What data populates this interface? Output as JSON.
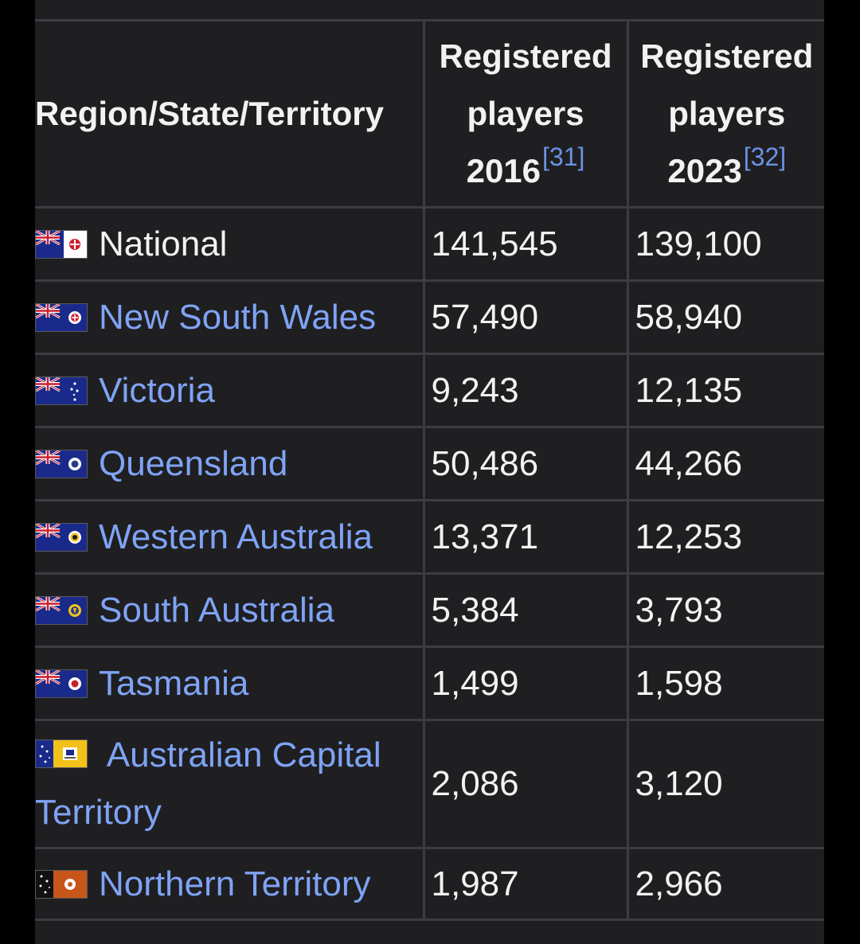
{
  "table": {
    "headers": {
      "region": "Region/State/Territory",
      "players_2016": {
        "line1": "Registered",
        "line2": "players",
        "line3": "2016",
        "ref": "[31]"
      },
      "players_2023": {
        "line1": "Registered",
        "line2": "players",
        "line3": "2023",
        "ref": "[32]"
      }
    },
    "rows": [
      {
        "region": "National",
        "players_2016": "141,545",
        "players_2023": "139,100",
        "flag": "australia-flag-icon"
      },
      {
        "region": "New South Wales",
        "players_2016": "57,490",
        "players_2023": "58,940",
        "flag": "new-south-wales-flag-icon"
      },
      {
        "region": "Victoria",
        "players_2016": "9,243",
        "players_2023": "12,135",
        "flag": "victoria-flag-icon"
      },
      {
        "region": "Queensland",
        "players_2016": "50,486",
        "players_2023": "44,266",
        "flag": "queensland-flag-icon"
      },
      {
        "region": "Western Australia",
        "players_2016": "13,371",
        "players_2023": "12,253",
        "flag": "western-australia-flag-icon"
      },
      {
        "region": "South Australia",
        "players_2016": "5,384",
        "players_2023": "3,793",
        "flag": "south-australia-flag-icon"
      },
      {
        "region": "Tasmania",
        "players_2016": "1,499",
        "players_2023": "1,598",
        "flag": "tasmania-flag-icon"
      },
      {
        "region_line1": "Australian Capital",
        "region_line2": "Territory",
        "players_2016": "2,086",
        "players_2023": "3,120",
        "flag": "act-flag-icon"
      },
      {
        "region": "Northern Territory",
        "players_2016": "1,987",
        "players_2023": "2,966",
        "flag": "northern-territory-flag-icon"
      }
    ]
  },
  "colors": {
    "background": "#1f1f21",
    "border": "#3c3d40",
    "text": "#f2f2f2",
    "link": "#7fa3f5",
    "reference": "#6a93e6"
  }
}
